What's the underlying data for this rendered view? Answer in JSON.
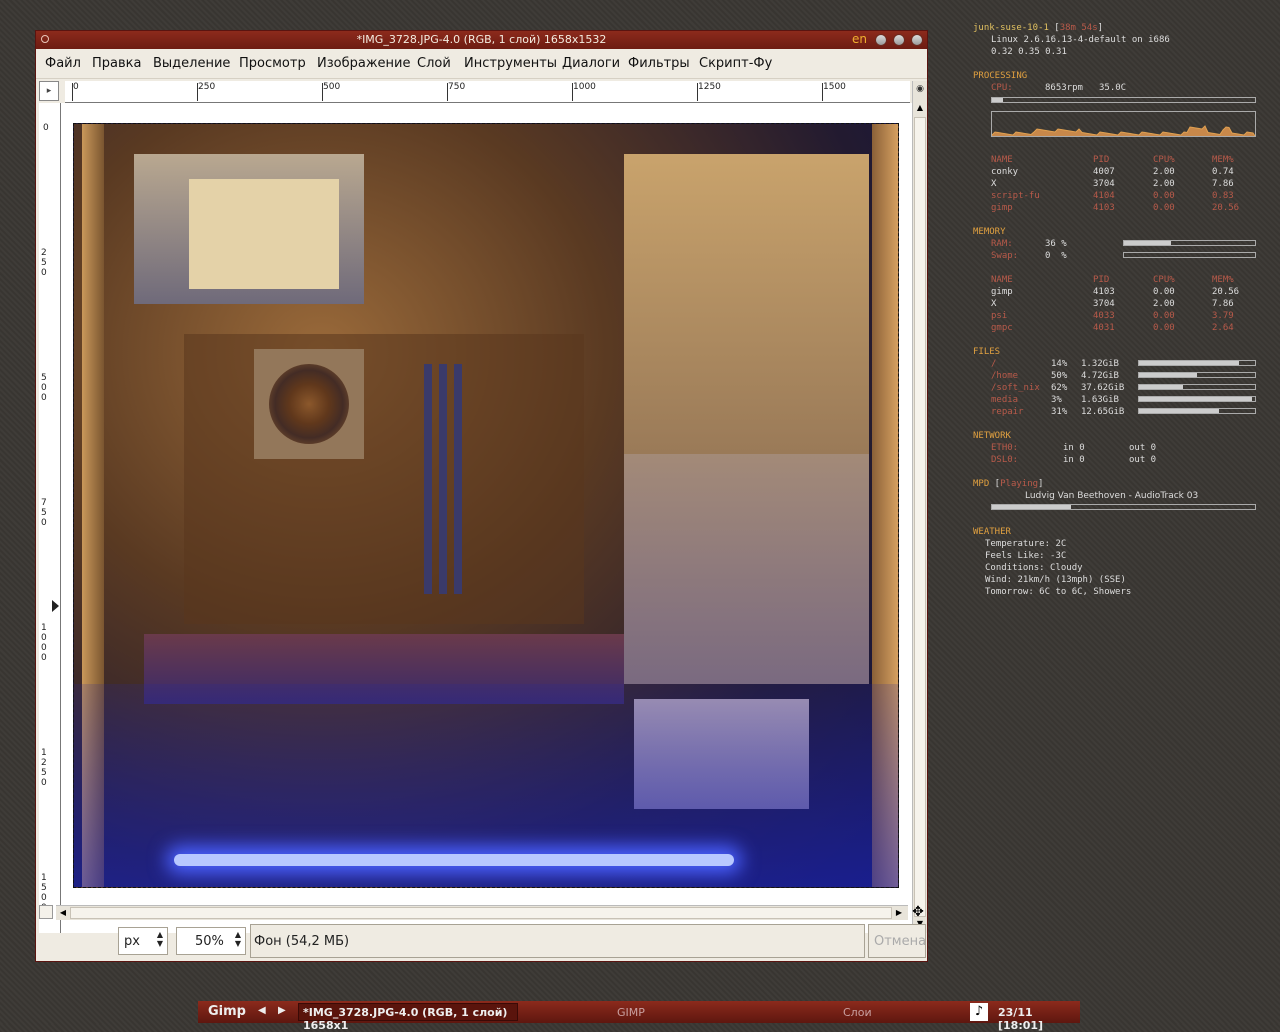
{
  "window": {
    "title": "*IMG_3728.JPG-4.0 (RGB, 1 слой) 1658x1532",
    "lang": "en"
  },
  "menu": [
    "Файл",
    "Правка",
    "Выделение",
    "Просмотр",
    "Изображение",
    "Слой",
    "Инструменты",
    "Диалоги",
    "Фильтры",
    "Скрипт-Фу"
  ],
  "ruler_h": [
    "0",
    "250",
    "500",
    "750",
    "1000",
    "1250",
    "1500"
  ],
  "ruler_v": [
    "0",
    "250",
    "500",
    "750",
    "1000",
    "1250",
    "1500"
  ],
  "status": {
    "unit": "px",
    "zoom": "50%",
    "info": "Фон (54,2 МБ)",
    "cancel": "Отмена"
  },
  "conky": {
    "host": "junk-suse-10-1",
    "uptime": "38m 54s",
    "kernel": "Linux 2.6.16.13-4-default on i686",
    "load": "0.32 0.35 0.31",
    "processing": "PROCESSING",
    "cpu_label": "CPU:",
    "cpu_rpm": "8653rpm",
    "cpu_temp": "35.0C",
    "cpu_fill": 0.04,
    "proc_header": [
      "NAME",
      "PID",
      "CPU%",
      "MEM%"
    ],
    "proc_rows": [
      [
        "conky",
        "4007",
        "2.00",
        "0.74"
      ],
      [
        "X",
        "3704",
        "2.00",
        "7.86"
      ],
      [
        "script-fu",
        "4104",
        "0.00",
        "0.83"
      ],
      [
        "gimp",
        "4103",
        "0.00",
        "20.56"
      ]
    ],
    "memory": "MEMORY",
    "ram": "RAM:",
    "ram_val": "36 %",
    "ram_fill": 0.36,
    "swap": "Swap:",
    "swap_val": "0  %",
    "swap_fill": 0,
    "mem_header": [
      "NAME",
      "PID",
      "CPU%",
      "MEM%"
    ],
    "mem_rows": [
      [
        "gimp",
        "4103",
        "0.00",
        "20.56"
      ],
      [
        "X",
        "3704",
        "2.00",
        "7.86"
      ],
      [
        "psi",
        "4033",
        "0.00",
        "3.79"
      ],
      [
        "gmpc",
        "4031",
        "0.00",
        "2.64"
      ]
    ],
    "files": "FILES",
    "file_rows": [
      [
        "/",
        "14%",
        "1.32GiB",
        0.86
      ],
      [
        "/home",
        "50%",
        "4.72GiB",
        0.5
      ],
      [
        "/soft_nix",
        "62%",
        "37.62GiB",
        0.38
      ],
      [
        "media",
        "3%",
        "1.63GiB",
        0.97
      ],
      [
        "repair",
        "31%",
        "12.65GiB",
        0.69
      ]
    ],
    "network": "NETWORK",
    "net_rows": [
      [
        "ETH0:",
        "in 0",
        "out 0"
      ],
      [
        "DSL0:",
        "in 0",
        "out 0"
      ]
    ],
    "mpd": "MPD",
    "mpd_state": "Playing",
    "track": "Ludvig Van Beethoven - AudioTrack 03",
    "track_fill": 0.3,
    "weather": "WEATHER",
    "weather_rows": [
      "Temperature: 2C",
      "Feels Like: -3C",
      "Conditions: Cloudy",
      "Wind: 21km/h (13mph) (SSE)",
      "Tomorrow: 6C to 6C, Showers"
    ]
  },
  "taskbar": {
    "app": "Gimp",
    "task1": "*IMG_3728.JPG-4.0 (RGB, 1 слой) 1658x1",
    "task2": "GIMP",
    "task3": "Слои",
    "clock": "23/11 [18:01]"
  }
}
